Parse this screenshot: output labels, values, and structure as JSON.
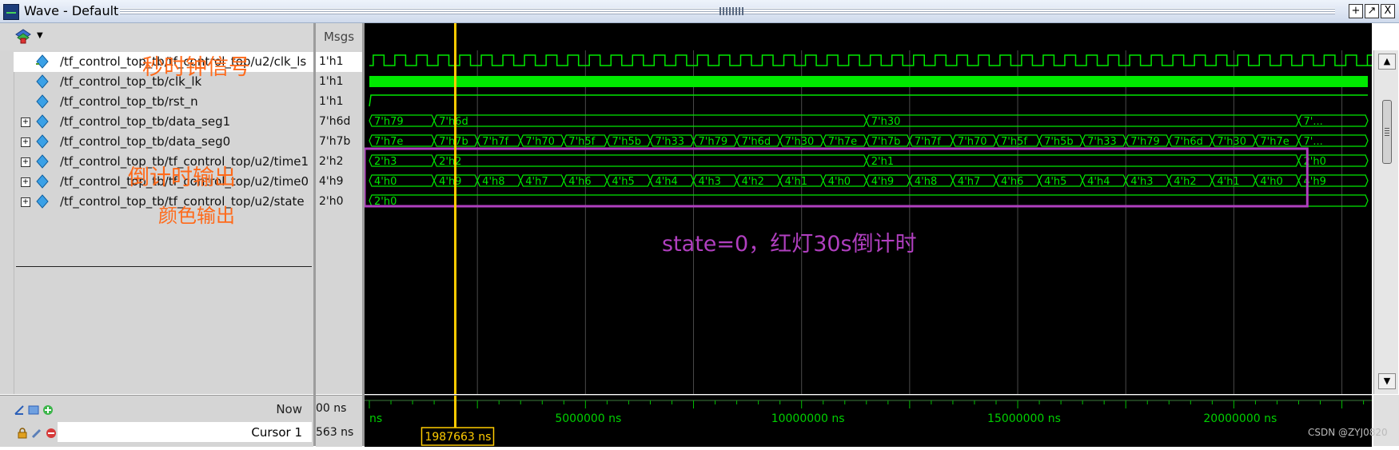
{
  "window": {
    "title": "Wave - Default",
    "buttons": [
      "+",
      "↗",
      "X"
    ]
  },
  "header": {
    "msgs_label": "Msgs",
    "toolbar_icon": "layers-dropdown-icon"
  },
  "signals": [
    {
      "name": "/tf_control_top_tb/tf_control_top/u2/clk_ls",
      "value": "1'h1",
      "type": "clock",
      "expandable": false,
      "selected": true
    },
    {
      "name": "/tf_control_top_tb/clk_lk",
      "value": "1'h1",
      "type": "fast-clock",
      "expandable": false,
      "selected": false
    },
    {
      "name": "/tf_control_top_tb/rst_n",
      "value": "1'h1",
      "type": "high",
      "expandable": false,
      "selected": false
    },
    {
      "name": "/tf_control_top_tb/data_seg1",
      "value": "7'h6d",
      "type": "bus",
      "expandable": true,
      "selected": false
    },
    {
      "name": "/tf_control_top_tb/data_seg0",
      "value": "7'h7b",
      "type": "bus",
      "expandable": true,
      "selected": false
    },
    {
      "name": "/tf_control_top_tb/tf_control_top/u2/time1",
      "value": "2'h2",
      "type": "bus",
      "expandable": true,
      "selected": false
    },
    {
      "name": "/tf_control_top_tb/tf_control_top/u2/time0",
      "value": "4'h9",
      "type": "bus",
      "expandable": true,
      "selected": false
    },
    {
      "name": "/tf_control_top_tb/tf_control_top/u2/state",
      "value": "2'h0",
      "type": "bus",
      "expandable": true,
      "selected": false
    }
  ],
  "buses": {
    "data_seg1": [
      "7'h79",
      "7'h6d",
      "7'h30",
      "7'..."
    ],
    "data_seg0": [
      "7'h7e",
      "7'h7b",
      "7'h7f",
      "7'h70",
      "7'h5f",
      "7'h5b",
      "7'h33",
      "7'h79",
      "7'h6d",
      "7'h30",
      "7'h7e",
      "7'h7b",
      "7'h7f",
      "7'h70",
      "7'h5f",
      "7'h5b",
      "7'h33",
      "7'h79",
      "7'h6d",
      "7'h30",
      "7'h7e",
      "7'..."
    ],
    "time1": [
      "2'h3",
      "2'h2",
      "2'h1",
      "2'h0"
    ],
    "time0": [
      "4'h0",
      "4'h9",
      "4'h8",
      "4'h7",
      "4'h6",
      "4'h5",
      "4'h4",
      "4'h3",
      "4'h2",
      "4'h1",
      "4'h0",
      "4'h9",
      "4'h8",
      "4'h7",
      "4'h6",
      "4'h5",
      "4'h4",
      "4'h3",
      "4'h2",
      "4'h1",
      "4'h0",
      "4'h9"
    ],
    "state": [
      "2'h0"
    ]
  },
  "timeline": {
    "now_label": "Now",
    "now_value": "00 ns",
    "cursor_label": "Cursor 1",
    "cursor_value": "563 ns",
    "cursor_time": "1987663 ns",
    "cursor_ns": 1987663,
    "range_ns": [
      0,
      23100000
    ],
    "ticks": [
      "ns",
      "5000000 ns",
      "10000000 ns",
      "15000000 ns",
      "20000000 ns"
    ]
  },
  "annotations": {
    "clock_note": "秒时钟信号",
    "countdown_note": "倒计时输出",
    "color_note": "颜色输出",
    "state_note": "state=0，红灯30s倒计时"
  },
  "watermark": "CSDN @ZYJ0820",
  "colors": {
    "wave_green": "#00e800",
    "cursor": "#ffcc00",
    "highlight_box": "#b03fbf",
    "annotation_orange": "#ff6a1a",
    "grid": "#4a4a4a"
  }
}
